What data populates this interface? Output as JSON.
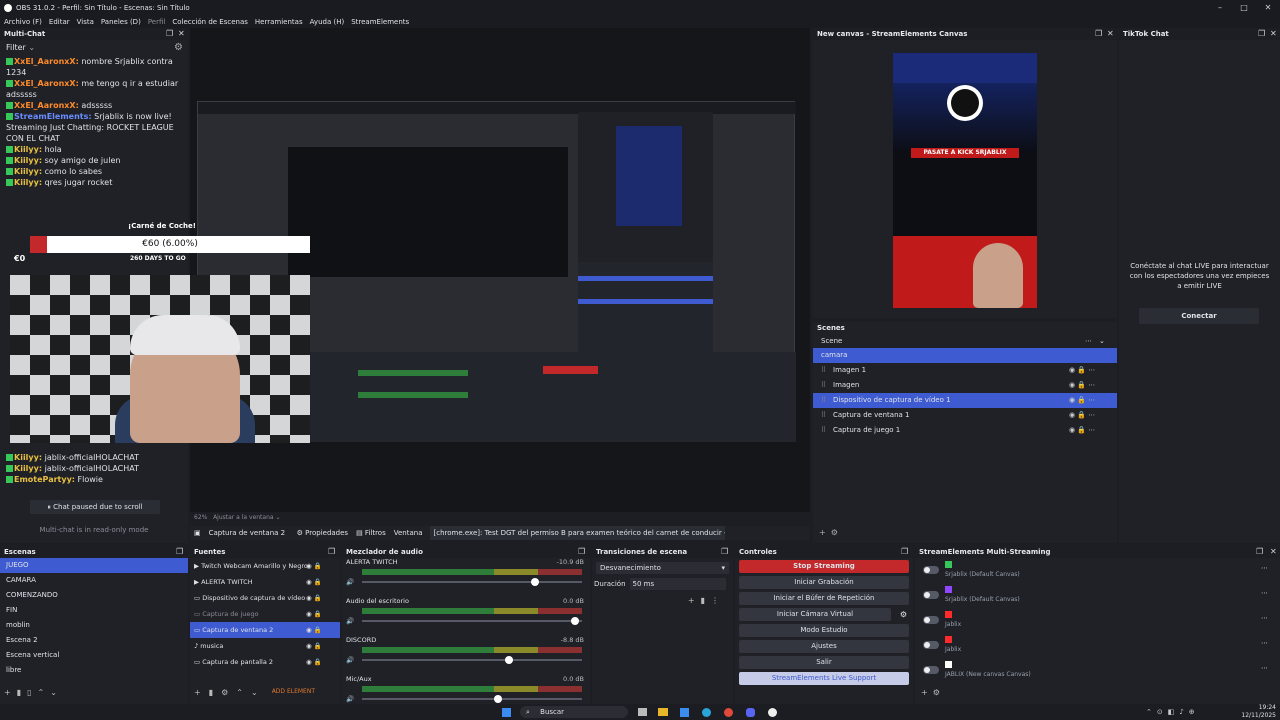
{
  "window": {
    "title": "OBS 31.0.2 - Perfil: Sin Título - Escenas: Sin Título"
  },
  "menu": [
    "Archivo (F)",
    "Editar",
    "Vista",
    "Paneles (D)",
    "Perfil",
    "Colección de Escenas",
    "Herramientas",
    "Ayuda (H)",
    "StreamElements"
  ],
  "multichat": {
    "title": "Multi-Chat",
    "filter": "Filter",
    "messages": [
      {
        "nick": "XxEl_AaronxX:",
        "text": " nombre Srjablix contra 1234",
        "color": "#ff8a2a"
      },
      {
        "nick": "XxEl_AaronxX:",
        "text": " me tengo q ir a estudiar adsssss",
        "color": "#ff8a2a"
      },
      {
        "nick": "XxEl_AaronxX:",
        "text": " adsssss",
        "color": "#ff8a2a"
      },
      {
        "nick": "StreamElements:",
        "text": " Srjablix is now live! Streaming Just Chatting: ROCKET LEAGUE CON EL CHAT",
        "color": "#6a8cff"
      },
      {
        "nick": "Kiilyy:",
        "text": " hola",
        "color": "#e8c040"
      },
      {
        "nick": "Kiilyy:",
        "text": " soy amigo de julen",
        "color": "#e8c040"
      },
      {
        "nick": "Kiilyy:",
        "text": " como lo sabes",
        "color": "#e8c040"
      },
      {
        "nick": "Kiilyy:",
        "text": " qres jugar rocket",
        "color": "#e8c040"
      }
    ],
    "bottom_messages": [
      {
        "nick": "Kiilyy:",
        "text": " jablix-officialHOLACHAT",
        "color": "#e8c040"
      },
      {
        "nick": "Kiilyy:",
        "text": " jablix-officialHOLACHAT",
        "color": "#e8c040"
      },
      {
        "nick": "EmotePartyy:",
        "text": " Flowie",
        "color": "#e8c040"
      }
    ],
    "paused": "Chat paused due to scroll",
    "readonly": "Multi-chat is in read-only mode"
  },
  "overlay": {
    "goal_label": "¡Carné de Coche!",
    "goal_amount": "€60 (6.00%)",
    "days": "260 DAYS TO GO",
    "zero": "€0"
  },
  "preview_footer": {
    "zoom": "62%",
    "fit": "Ajustar a la ventana"
  },
  "source_bar": {
    "source": "Captura de ventana 2",
    "properties": "Propiedades",
    "filters": "Filtros",
    "window_label": "Ventana",
    "window_value": "[chrome.exe]: Test DGT del permiso B para examen teórico del carnet de conducir - TodoTest - Go"
  },
  "canvas": {
    "title": "New canvas - StreamElements Canvas",
    "banner": "PASATE A KICK SRJABLIX",
    "scenes_title": "Scenes",
    "scene_header": "Scene",
    "scenes": [
      "camara",
      "Imagen 1",
      "Imagen",
      "Dispositivo de captura de vídeo 1",
      "Captura de ventana 1",
      "Captura de juego 1"
    ]
  },
  "tiktok": {
    "title": "TikTok Chat",
    "message": "Conéctate al chat LIVE para interactuar con los espectadores una vez empieces a emitir LIVE",
    "button": "Conectar"
  },
  "scenes": {
    "title": "Escenas",
    "items": [
      "JUEGO",
      "CAMARA",
      "COMENZANDO",
      "FIN",
      "moblin",
      "Escena 2",
      "Escena vertical",
      "libre"
    ]
  },
  "sources": {
    "title": "Fuentes",
    "items": [
      "Twitch Webcam Amarillo y Negro",
      "ALERTA TWITCH",
      "Dispositivo de captura de vídeo",
      "Captura de juego",
      "Captura de ventana 2",
      "musica",
      "Captura de pantalla 2"
    ],
    "add": "ADD ELEMENT"
  },
  "mixer": {
    "title": "Mezclador de audio",
    "channels": [
      {
        "name": "ALERTA TWITCH",
        "db": "-10.9 dB",
        "level": 0.77
      },
      {
        "name": "Audio del escritorio",
        "db": "0.0 dB",
        "level": 0.95
      },
      {
        "name": "DISCORD",
        "db": "-8.8 dB",
        "level": 0.65
      },
      {
        "name": "Mic/Aux",
        "db": "0.0 dB",
        "level": 0.6
      }
    ]
  },
  "transitions": {
    "title": "Transiciones de escena",
    "type": "Desvanecimiento",
    "duration_label": "Duración",
    "duration": "50 ms"
  },
  "controls": {
    "title": "Controles",
    "buttons": [
      "Stop Streaming",
      "Iniciar Grabación",
      "Iniciar el Búfer de Repetición",
      "Iniciar Cámara Virtual",
      "Modo Estudio",
      "Ajustes",
      "Salir",
      "StreamElements Live Support"
    ]
  },
  "multistream": {
    "title": "StreamElements Multi-Streaming",
    "items": [
      {
        "name": "Srjablix (Default Canvas)",
        "color": "#37c85a"
      },
      {
        "name": "Srjablix (Default Canvas)",
        "color": "#9146ff"
      },
      {
        "name": "Jablix",
        "color": "#ff2b2b"
      },
      {
        "name": "Jablix",
        "color": "#ff2b2b"
      },
      {
        "name": "JABLIX (New canvas Canvas)",
        "color": "#ffffff"
      }
    ]
  },
  "taskbar": {
    "search": "Buscar",
    "time": "19:24",
    "date": "12/11/2025"
  },
  "colors": {
    "accent": "#3e5bd1",
    "stop": "#c3282a"
  }
}
